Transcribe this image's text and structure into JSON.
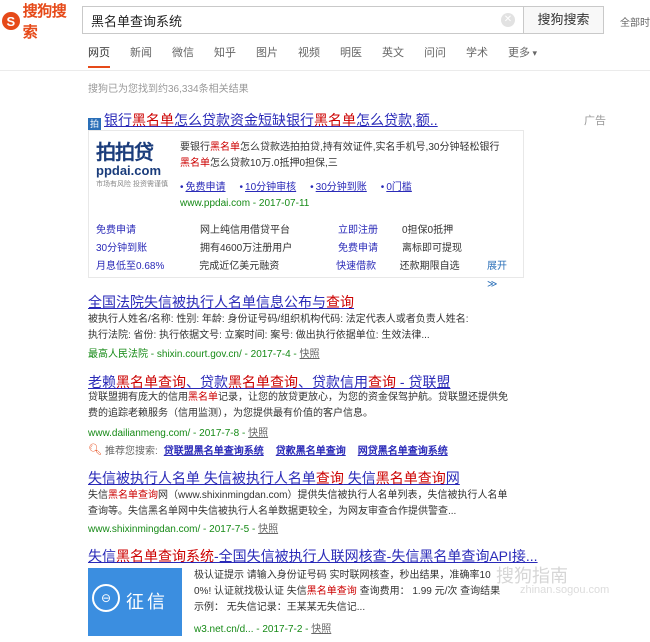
{
  "header": {
    "logo_text": "搜狗搜索",
    "search_value": "黑名单查询系统",
    "search_button": "搜狗搜索",
    "top_right": "全部时"
  },
  "tabs": [
    "网页",
    "新闻",
    "微信",
    "知乎",
    "图片",
    "视频",
    "明医",
    "英文",
    "问问",
    "学术",
    "更多"
  ],
  "result_count": "搜狗已为您找到约36,334条相关结果",
  "ad": {
    "title_parts": [
      "银行",
      "黑名单",
      "怎么贷款资金短缺银行",
      "黑名单",
      "怎么贷款,额.."
    ],
    "tag": "广告",
    "logo_cn": "拍拍贷",
    "logo_en": "ppdai.com",
    "logo_sub": "市场有风险 投资需谨慎",
    "desc_parts": [
      "要银行",
      "黑名单",
      "怎么贷款选拍拍贷,持有效证件,实名手机号,30分钟轻松银行",
      "黑名单",
      "怎么贷款10万.0抵押0担保,三"
    ],
    "links": [
      "免费申请",
      "10分钟审核",
      "30分钟到账",
      "0门槛"
    ],
    "url": "www.ppdai.com - 2017-07-11",
    "grid": [
      [
        "免费申请",
        "网上纯信用借贷平台",
        "立即注册",
        "0担保0抵押",
        ""
      ],
      [
        "30分钟到账",
        "拥有4600万注册用户",
        "免费申请",
        "离标即可提现",
        ""
      ],
      [
        "月息低至0.68%",
        "完成近亿美元融资",
        "快速借款",
        "还款期限自选",
        "展开 ≫"
      ]
    ]
  },
  "results": [
    {
      "title_parts": [
        "全国法院失信被执行人名单信息公布与",
        "查询"
      ],
      "body": [
        "被执行人姓名/名称: 性别: 年龄: 身份证号码/组织机构代码: 法定代表人或者负责人姓名:",
        "执行法院: 省份: 执行依据文号: 立案时间: 案号: 做出执行依据单位: 生效法律..."
      ],
      "url": "最高人民法院 - shixin.court.gov.cn/ - 2017-7-4 - ",
      "cache": "快照"
    },
    {
      "title_parts": [
        "老赖",
        "黑名单查询",
        "、贷款",
        "黑名单查询",
        "、贷款信用",
        "查询",
        " - 贷联盟"
      ],
      "body_parts": [
        "贷联盟拥有庞大的信用",
        "黑名单",
        "记录，让您的放贷更放心，为您的资金保驾护航。贷联盟还提供免",
        "费的追踪老赖服务（信用监测），为您提供最有价值的客户信息。"
      ],
      "url": "www.dailianmeng.com/ - 2017-7-8 - ",
      "cache": "快照"
    },
    {
      "title_parts": [
        "失信被执行人名单 失信被执行人名单",
        "查询",
        " 失信",
        "黑名单查询",
        "网"
      ],
      "body_parts": [
        "失信",
        "黑名单查询",
        "网（www.shixinmingdan.com）提供失信被执行人名单列表，失信被执行人名单",
        "查询等。失信黑名单网中失信被执行人名单数据更较全，为网友审查合作提供警查..."
      ],
      "url": "www.shixinmingdan.com/ - 2017-7-5 - ",
      "cache": "快照"
    },
    {
      "title_parts": [
        "失信",
        "黑名单查询系统",
        "-全国失信被执行人联网核查-失信黑名单查询API接..."
      ],
      "body_parts": [
        "极认证提示 请输入身份证号码 实时联网核查，秒出结果，准确率10",
        "0%! 认证就找极认证 失信",
        "黑名单查询",
        " 查询费用： 1.99 元/次 查询结果",
        "示例： 无失信记录：王某某无失信记..."
      ],
      "url": "w3.net.cn/d... - 2017-7-2 - ",
      "cache": "快照",
      "image_text": "征信"
    }
  ],
  "recommend": {
    "label": "推荐您搜索:",
    "links": [
      "贷联盟黑名单查询系统",
      "贷款黑名单查询",
      "网贷黑名单查询系统"
    ]
  },
  "watermark": {
    "line1": "搜狗指南",
    "line2": "zhinan.sogou.com"
  },
  "colors": {
    "brand": "#e64a19",
    "link": "#2a2ab8",
    "highlight": "#c00",
    "url": "#168a16"
  }
}
